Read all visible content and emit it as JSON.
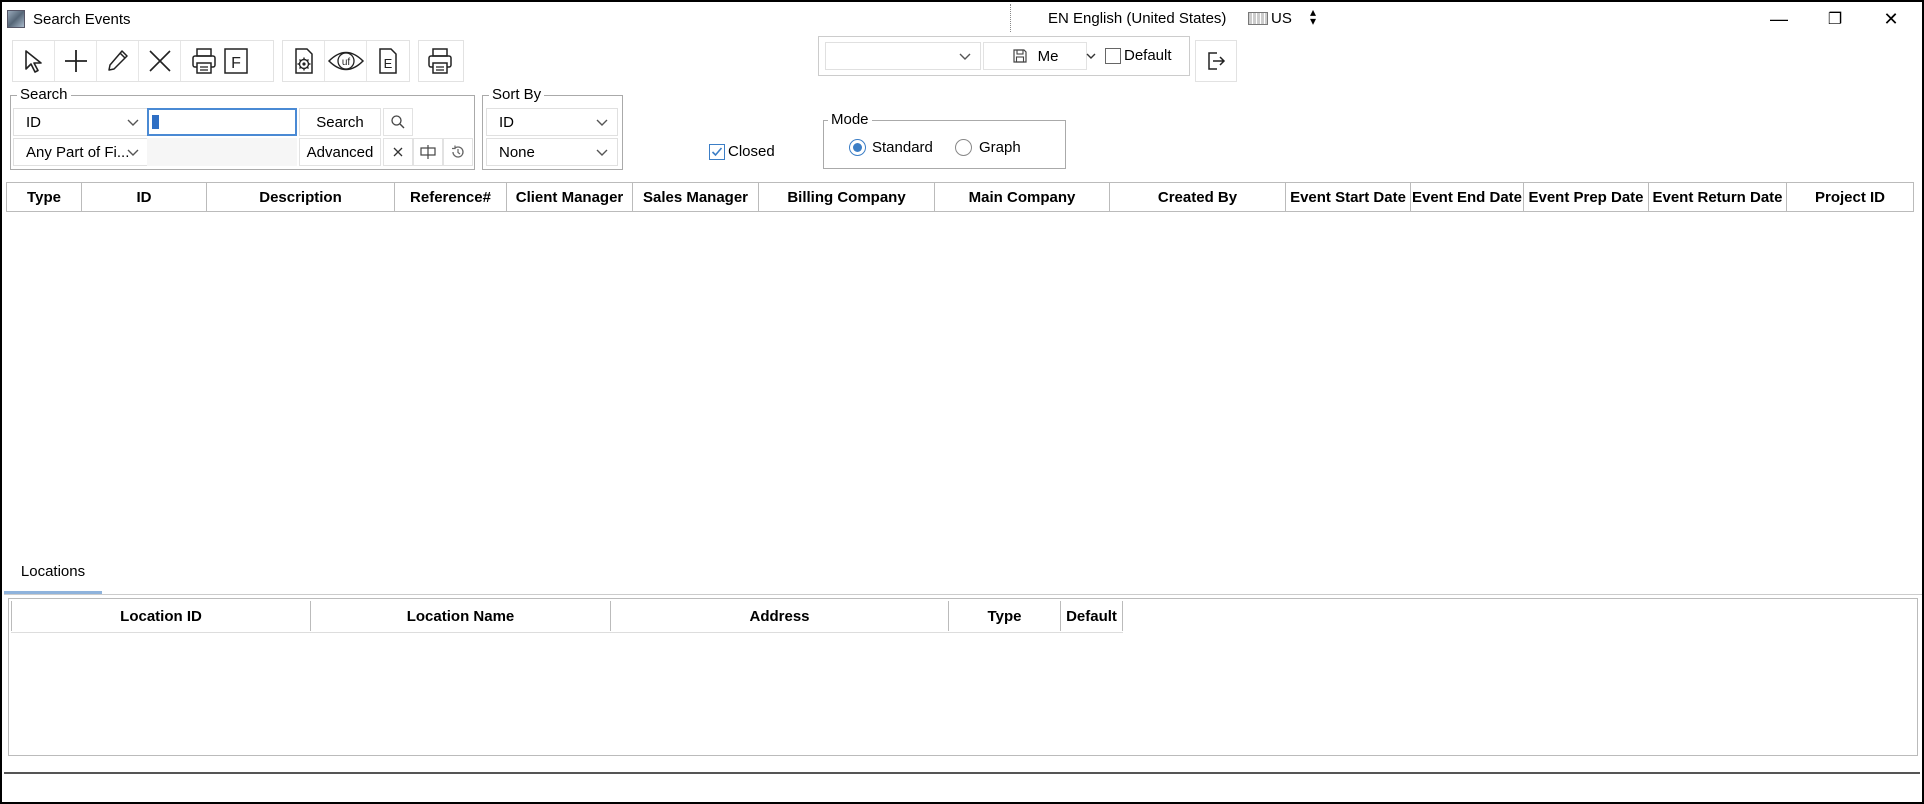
{
  "window": {
    "title": "Search Events"
  },
  "language": {
    "label": "EN English (United States)",
    "keyboard": "US"
  },
  "window_controls": {
    "minimize": "—",
    "restore": "❐",
    "close": "✕"
  },
  "toolbar": {
    "icons": [
      "select-icon",
      "add-icon",
      "edit-icon",
      "delete-icon",
      "print-form-icon",
      "settings-doc-icon",
      "uf-view-icon",
      "e-doc-icon",
      "print-icon"
    ],
    "print_form_letter": "F",
    "uf_label": "uf",
    "e_label": "E"
  },
  "view": {
    "layout_value": "",
    "save_label": "Me",
    "default_label": "Default",
    "default_checked": false
  },
  "search": {
    "legend": "Search",
    "field_value": "ID",
    "match_value": "Any Part of Fi...",
    "query_value": "",
    "search_button": "Search",
    "advanced_button": "Advanced"
  },
  "sort": {
    "legend": "Sort By",
    "primary": "ID",
    "secondary": "None"
  },
  "closed": {
    "label": "Closed",
    "checked": true
  },
  "mode": {
    "legend": "Mode",
    "options": [
      "Standard",
      "Graph"
    ],
    "selected": "Standard"
  },
  "grid": {
    "columns": [
      "Type",
      "ID",
      "Description",
      "Reference#",
      "Client Manager",
      "Sales Manager",
      "Billing Company",
      "Main Company",
      "Created By",
      "Event Start Date",
      "Event End Date",
      "Event Prep Date",
      "Event Return Date",
      "Project ID"
    ],
    "rows": []
  },
  "tabs": [
    "Locations"
  ],
  "locations": {
    "columns": [
      "Location ID",
      "Location Name",
      "Address",
      "Type",
      "Default"
    ],
    "rows": []
  },
  "status": {
    "text": ""
  }
}
